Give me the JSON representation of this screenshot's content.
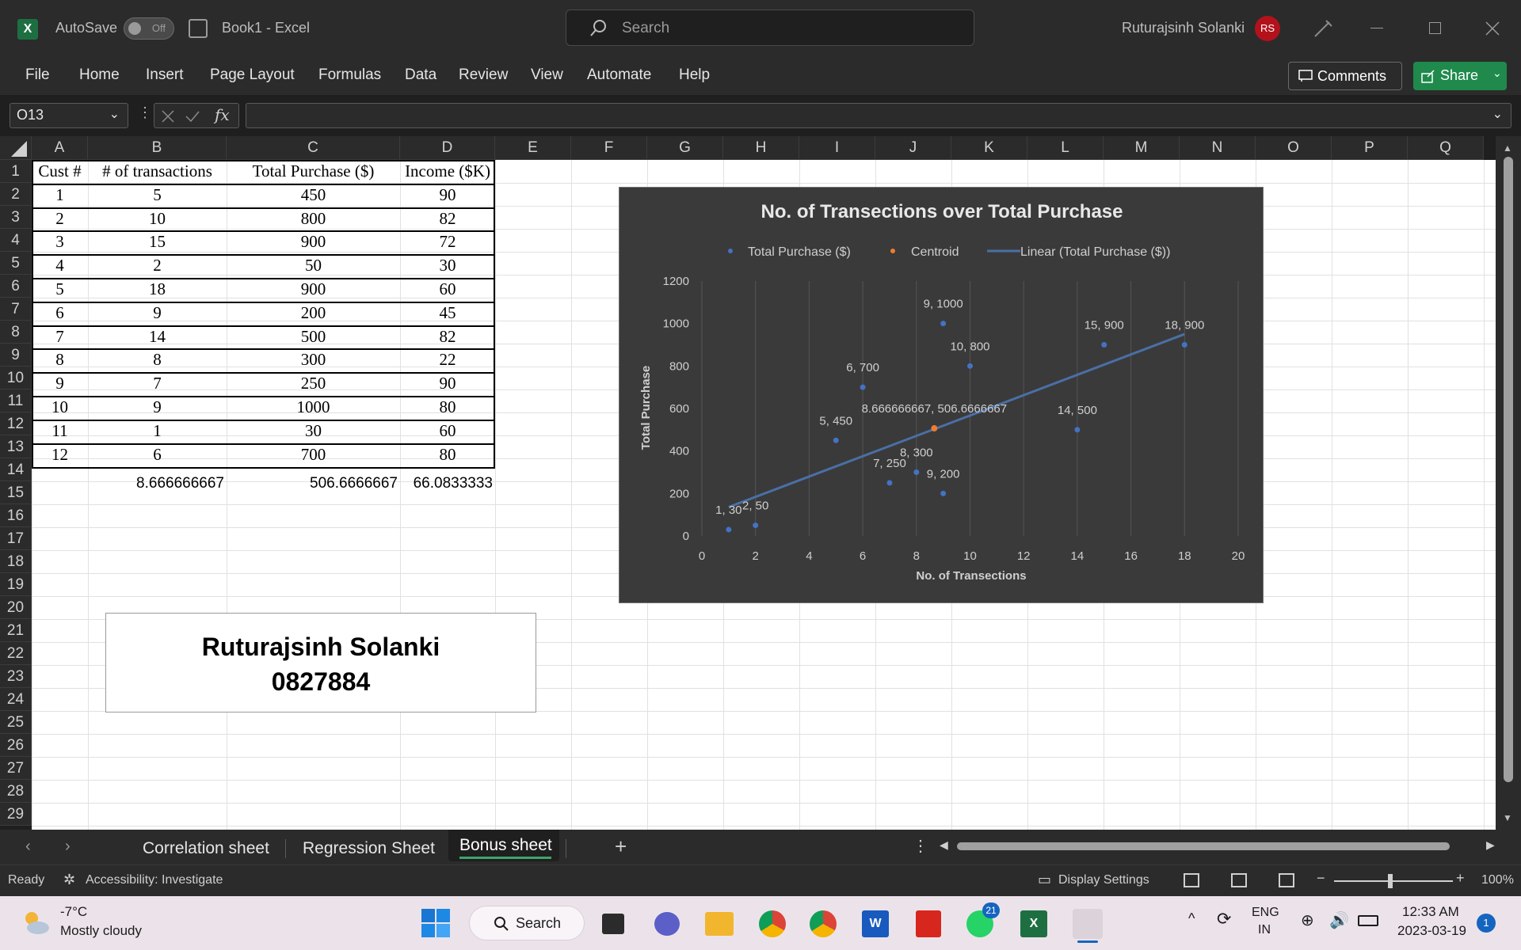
{
  "titlebar": {
    "autosave_label": "AutoSave",
    "autosave_state": "Off",
    "doc_title": "Book1  -  Excel",
    "search_placeholder": "Search",
    "user_name": "Ruturajsinh Solanki",
    "user_initials": "RS"
  },
  "menu": [
    "File",
    "Home",
    "Insert",
    "Page Layout",
    "Formulas",
    "Data",
    "Review",
    "View",
    "Automate",
    "Help"
  ],
  "buttons": {
    "comments": "Comments",
    "share": "Share"
  },
  "formula_bar": {
    "name_box": "O13",
    "formula": ""
  },
  "columns": [
    "A",
    "B",
    "C",
    "D",
    "E",
    "F",
    "G",
    "H",
    "I",
    "J",
    "K",
    "L",
    "M",
    "N",
    "O",
    "P",
    "Q"
  ],
  "rows": [
    "1",
    "2",
    "3",
    "4",
    "5",
    "6",
    "7",
    "8",
    "9",
    "10",
    "11",
    "12",
    "13",
    "14",
    "15",
    "16",
    "17",
    "18",
    "19",
    "20",
    "21",
    "22",
    "23",
    "24",
    "25",
    "26",
    "27",
    "28",
    "29"
  ],
  "table": {
    "headers": [
      "Cust #",
      "# of transactions",
      "Total Purchase ($)",
      "Income ($K)"
    ],
    "rows": [
      [
        "1",
        "5",
        "450",
        "90"
      ],
      [
        "2",
        "10",
        "800",
        "82"
      ],
      [
        "3",
        "15",
        "900",
        "72"
      ],
      [
        "4",
        "2",
        "50",
        "30"
      ],
      [
        "5",
        "18",
        "900",
        "60"
      ],
      [
        "6",
        "9",
        "200",
        "45"
      ],
      [
        "7",
        "14",
        "500",
        "82"
      ],
      [
        "8",
        "8",
        "300",
        "22"
      ],
      [
        "9",
        "7",
        "250",
        "90"
      ],
      [
        "10",
        "9",
        "1000",
        "80"
      ],
      [
        "11",
        "1",
        "30",
        "60"
      ],
      [
        "12",
        "6",
        "700",
        "80"
      ]
    ],
    "averages": [
      "8.666666667",
      "506.6666667",
      "66.0833333"
    ]
  },
  "name_card": {
    "line1": "Ruturajsinh Solanki",
    "line2": "0827884"
  },
  "chart_data": {
    "type": "scatter",
    "title": "No. of Transections over Total Purchase",
    "xlabel": "No. of Transections",
    "ylabel": "Total Purchase",
    "xlim": [
      0,
      20
    ],
    "ylim": [
      0,
      1200
    ],
    "xticks": [
      0,
      2,
      4,
      6,
      8,
      10,
      12,
      14,
      16,
      18,
      20
    ],
    "yticks": [
      0,
      200,
      400,
      600,
      800,
      1000,
      1200
    ],
    "legend": [
      "Total Purchase ($)",
      "Centroid",
      "Linear (Total Purchase ($))"
    ],
    "legend_position": "top",
    "series": [
      {
        "name": "Total Purchase ($)",
        "color": "#4472c4",
        "points": [
          [
            5,
            450
          ],
          [
            10,
            800
          ],
          [
            15,
            900
          ],
          [
            2,
            50
          ],
          [
            18,
            900
          ],
          [
            9,
            200
          ],
          [
            14,
            500
          ],
          [
            8,
            300
          ],
          [
            7,
            250
          ],
          [
            9,
            1000
          ],
          [
            1,
            30
          ],
          [
            6,
            700
          ]
        ],
        "labels": [
          "5, 450",
          "10, 800",
          "15, 900",
          "2, 50",
          "18, 900",
          "9, 200",
          "14, 500",
          "8, 300",
          "7, 250",
          "9, 1000",
          "1, 30",
          "6, 700"
        ]
      },
      {
        "name": "Centroid",
        "color": "#ed7d31",
        "points": [
          [
            8.666666667,
            506.6666667
          ]
        ],
        "labels": [
          "8.666666667, 506.6666667"
        ]
      }
    ],
    "trendline": {
      "name": "Linear (Total Purchase ($))",
      "color": "#4a6fa5",
      "x": [
        1,
        18
      ],
      "y": [
        136,
        950
      ]
    },
    "grid": "vertical"
  },
  "sheet_tabs": [
    "Correlation sheet",
    "Regression Sheet",
    "Bonus sheet"
  ],
  "active_tab": "Bonus sheet",
  "status": {
    "ready": "Ready",
    "accessibility": "Accessibility: Investigate",
    "display_settings": "Display Settings",
    "zoom": "100%"
  },
  "taskbar": {
    "weather_temp": "-7°C",
    "weather_desc": "Mostly cloudy",
    "search": "Search",
    "lang1": "ENG",
    "lang2": "IN",
    "time": "12:33 AM",
    "date": "2023-03-19",
    "notif_count": "1",
    "whatsapp_badge": "21"
  }
}
